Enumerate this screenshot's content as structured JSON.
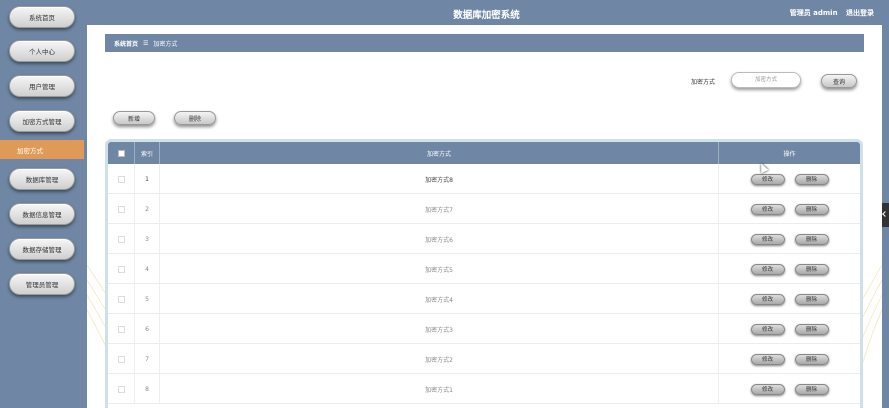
{
  "header": {
    "title": "数据库加密系统",
    "user": "管理员 admin",
    "logout": "退出登录"
  },
  "sidebar": {
    "items": [
      {
        "label": "系统首页"
      },
      {
        "label": "个人中心"
      },
      {
        "label": "用户管理"
      },
      {
        "label": "加密方式管理"
      },
      {
        "label": "加密方式"
      },
      {
        "label": "数据库管理"
      },
      {
        "label": "数据信息管理"
      },
      {
        "label": "数据存储管理"
      },
      {
        "label": "管理员管理"
      }
    ]
  },
  "breadcrumb": {
    "home": "系统首页",
    "separator": "☰",
    "current": "加密方式"
  },
  "search": {
    "label": "加密方式",
    "placeholder": "加密方式",
    "button": "查询"
  },
  "toolbar": {
    "add": "新增",
    "delete": "删除"
  },
  "table": {
    "headers": {
      "index": "索引",
      "method": "加密方式",
      "actions": "操作"
    },
    "edit_label": "修改",
    "delete_label": "删除",
    "rows": [
      {
        "index": "1",
        "method": "加密方式8"
      },
      {
        "index": "2",
        "method": "加密方式7"
      },
      {
        "index": "3",
        "method": "加密方式6"
      },
      {
        "index": "4",
        "method": "加密方式5"
      },
      {
        "index": "5",
        "method": "加密方式4"
      },
      {
        "index": "6",
        "method": "加密方式3"
      },
      {
        "index": "7",
        "method": "加密方式2"
      },
      {
        "index": "8",
        "method": "加密方式1"
      }
    ]
  },
  "colors": {
    "primary": "#6f87a4",
    "active": "#e09a57"
  }
}
